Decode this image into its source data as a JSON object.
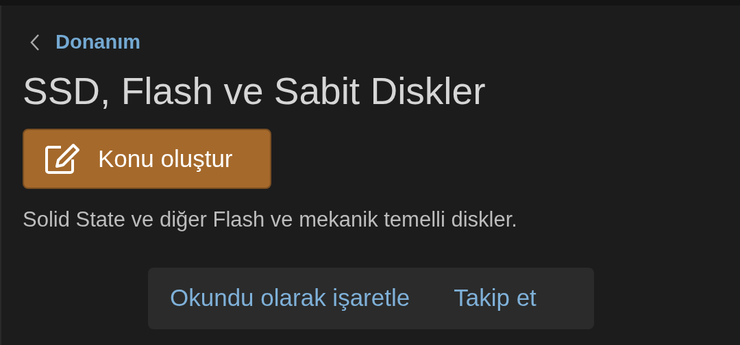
{
  "breadcrumb": {
    "label": "Donanım"
  },
  "title": "SSD, Flash ve Sabit Diskler",
  "create_button": {
    "label": "Konu oluştur"
  },
  "description": "Solid State ve diğer Flash ve mekanik temelli diskler.",
  "actions": [
    {
      "label": "Okundu olarak işaretle"
    },
    {
      "label": "Takip et"
    }
  ]
}
